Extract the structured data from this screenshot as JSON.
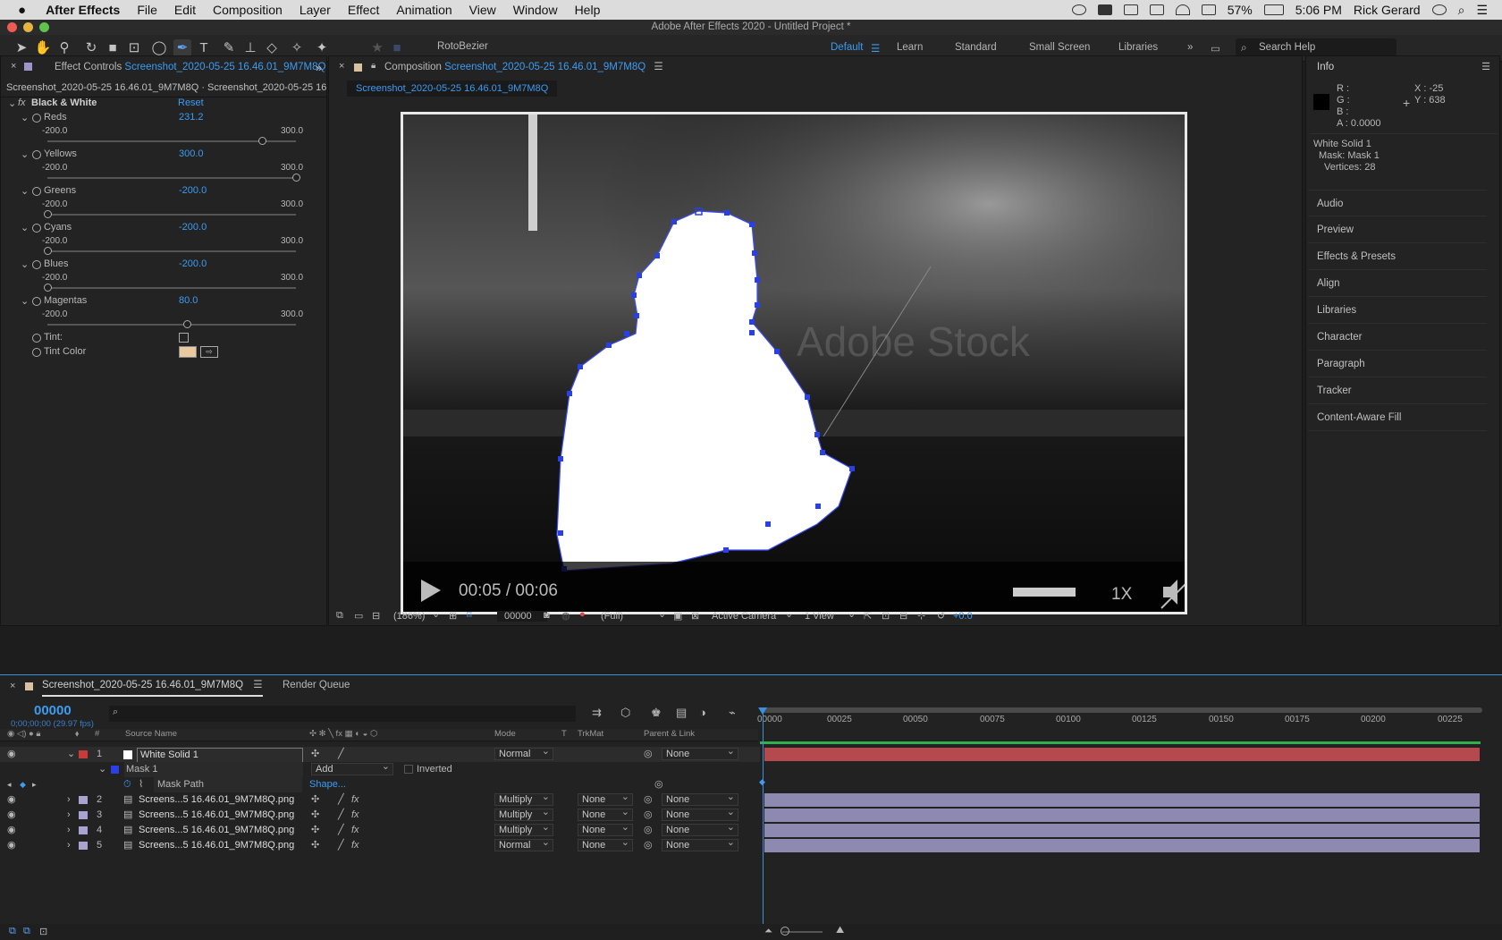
{
  "menubar": {
    "app": "After Effects",
    "items": [
      "File",
      "Edit",
      "Composition",
      "Layer",
      "Effect",
      "Animation",
      "View",
      "Window",
      "Help"
    ],
    "battery": "57%",
    "time": "5:06 PM",
    "user": "Rick Gerard"
  },
  "window_title": "Adobe After Effects 2020 - Untitled Project *",
  "toolbar": {
    "rotobezier": "RotoBezier",
    "workspaces": [
      "Default",
      "Learn",
      "Standard",
      "Small Screen",
      "Libraries"
    ],
    "search_placeholder": "Search Help"
  },
  "effect_controls": {
    "tab_label": "Effect Controls",
    "tab_source": "Screenshot_2020-05-25 16.46.01_9M7M8Q",
    "subheader": "Screenshot_2020-05-25 16.46.01_9M7M8Q · Screenshot_2020-05-25 16.46.01",
    "effect_name": "Black & White",
    "reset": "Reset",
    "params": [
      {
        "name": "Reds",
        "value": "231.2",
        "min": "-200.0",
        "max": "300.0",
        "fraction": 0.862
      },
      {
        "name": "Yellows",
        "value": "300.0",
        "min": "-200.0",
        "max": "300.0",
        "fraction": 1.0
      },
      {
        "name": "Greens",
        "value": "-200.0",
        "min": "-200.0",
        "max": "300.0",
        "fraction": 0.0
      },
      {
        "name": "Cyans",
        "value": "-200.0",
        "min": "-200.0",
        "max": "300.0",
        "fraction": 0.0
      },
      {
        "name": "Blues",
        "value": "-200.0",
        "min": "-200.0",
        "max": "300.0",
        "fraction": 0.0
      },
      {
        "name": "Magentas",
        "value": "80.0",
        "min": "-200.0",
        "max": "300.0",
        "fraction": 0.56
      }
    ],
    "tint": "Tint:",
    "tint_color": "Tint Color"
  },
  "composition": {
    "tab_label": "Composition",
    "tab_source": "Screenshot_2020-05-25 16.46.01_9M7M8Q",
    "subtab": "Screenshot_2020-05-25 16.46.01_9M7M8Q",
    "video_time": "00:05 / 00:06",
    "speed": "1X",
    "watermark": "Adobe Stock",
    "footer": {
      "zoom": "(186%)",
      "timecode": "00000",
      "resolution": "(Full)",
      "camera": "Active Camera",
      "views": "1 View",
      "exposure": "+0.0"
    }
  },
  "info": {
    "title": "Info",
    "r": "R :",
    "g": "G :",
    "b": "B :",
    "a": "A :  0.0000",
    "x": "X : -25",
    "y": "Y : 638",
    "layer": "White Solid 1",
    "mask": "Mask: Mask 1",
    "vertices": "Vertices: 28",
    "panels": [
      "Audio",
      "Preview",
      "Effects & Presets",
      "Align",
      "Libraries",
      "Character",
      "Paragraph",
      "Tracker",
      "Content-Aware Fill"
    ]
  },
  "timeline": {
    "tab_label": "Screenshot_2020-05-25 16.46.01_9M7M8Q",
    "render_queue": "Render Queue",
    "timecode": "00000",
    "fps": "0;00;00;00 (29.97 fps)",
    "headers": {
      "num": "#",
      "source": "Source Name",
      "mode": "Mode",
      "t": "T",
      "trkmat": "TrkMat",
      "parent": "Parent & Link"
    },
    "ruler": [
      "00000",
      "00025",
      "00050",
      "00075",
      "00100",
      "00125",
      "00150",
      "00175",
      "00200",
      "00225"
    ],
    "layers": [
      {
        "num": "1",
        "name": "White Solid 1",
        "mode": "Normal",
        "trkmat": "",
        "parent": "None",
        "color": "#c93b3b"
      },
      {
        "num": "2",
        "name": "Screens...5 16.46.01_9M7M8Q.png",
        "mode": "Multiply",
        "trkmat": "None",
        "parent": "None",
        "color": "#a9a3cf"
      },
      {
        "num": "3",
        "name": "Screens...5 16.46.01_9M7M8Q.png",
        "mode": "Multiply",
        "trkmat": "None",
        "parent": "None",
        "color": "#a9a3cf"
      },
      {
        "num": "4",
        "name": "Screens...5 16.46.01_9M7M8Q.png",
        "mode": "Multiply",
        "trkmat": "None",
        "parent": "None",
        "color": "#a9a3cf"
      },
      {
        "num": "5",
        "name": "Screens...5 16.46.01_9M7M8Q.png",
        "mode": "Normal",
        "trkmat": "None",
        "parent": "None",
        "color": "#a9a3cf"
      }
    ],
    "mask": {
      "name": "Mask 1",
      "mode": "Add",
      "inverted": "Inverted",
      "path_label": "Mask Path",
      "path_value": "Shape..."
    }
  },
  "colors": {
    "accent": "#3d9bf0",
    "mask_points": "#2b3fe6",
    "layer_red": "#b44a4d",
    "layer_purple": "#8e89b0"
  }
}
